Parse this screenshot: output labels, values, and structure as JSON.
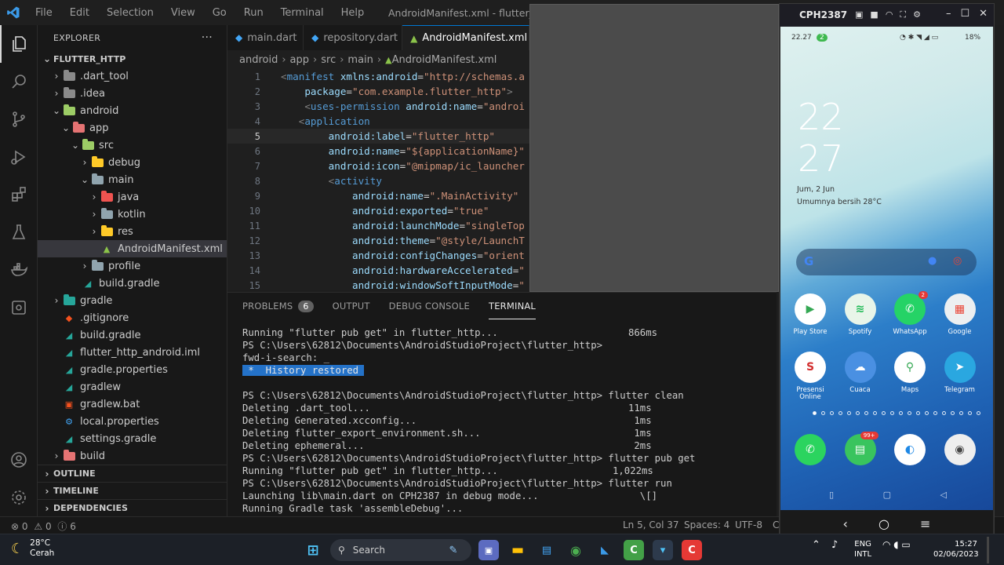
{
  "window": {
    "menu": [
      "File",
      "Edit",
      "Selection",
      "View",
      "Go",
      "Run",
      "Terminal",
      "Help"
    ],
    "title": "AndroidManifest.xml - flutter_http"
  },
  "explorer": {
    "header": "EXPLORER",
    "more": "···",
    "root": "FLUTTER_HTTP",
    "items": [
      {
        "label": ".dart_tool",
        "indent": 1,
        "chev": "›",
        "icon": "folder",
        "color": "#8a8a8a"
      },
      {
        "label": ".idea",
        "indent": 1,
        "chev": "›",
        "icon": "folder",
        "color": "#8a8a8a"
      },
      {
        "label": "android",
        "indent": 1,
        "chev": "⌄",
        "icon": "folder",
        "color": "#9ccc65"
      },
      {
        "label": "app",
        "indent": 2,
        "chev": "⌄",
        "icon": "folder",
        "color": "#e57373"
      },
      {
        "label": "src",
        "indent": 3,
        "chev": "⌄",
        "icon": "folder",
        "color": "#9ccc65"
      },
      {
        "label": "debug",
        "indent": 4,
        "chev": "›",
        "icon": "folder",
        "color": "#ffca28"
      },
      {
        "label": "main",
        "indent": 4,
        "chev": "⌄",
        "icon": "folder",
        "color": "#90a4ae"
      },
      {
        "label": "java",
        "indent": 5,
        "chev": "›",
        "icon": "folder",
        "color": "#ef5350"
      },
      {
        "label": "kotlin",
        "indent": 5,
        "chev": "›",
        "icon": "folder",
        "color": "#90a4ae"
      },
      {
        "label": "res",
        "indent": 5,
        "chev": "›",
        "icon": "folder",
        "color": "#ffca28"
      },
      {
        "label": "AndroidManifest.xml",
        "indent": 5,
        "chev": "",
        "icon": "android",
        "color": "#8bc34a",
        "selected": true
      },
      {
        "label": "profile",
        "indent": 4,
        "chev": "›",
        "icon": "folder",
        "color": "#90a4ae"
      },
      {
        "label": "build.gradle",
        "indent": 3,
        "chev": "",
        "icon": "gradle",
        "color": "#26a69a"
      },
      {
        "label": "gradle",
        "indent": 1,
        "chev": "›",
        "icon": "folder",
        "color": "#26a69a"
      },
      {
        "label": ".gitignore",
        "indent": 1,
        "chev": "",
        "icon": "git",
        "color": "#f4511e"
      },
      {
        "label": "build.gradle",
        "indent": 1,
        "chev": "",
        "icon": "gradle",
        "color": "#26a69a"
      },
      {
        "label": "flutter_http_android.iml",
        "indent": 1,
        "chev": "",
        "icon": "gradle",
        "color": "#26a69a"
      },
      {
        "label": "gradle.properties",
        "indent": 1,
        "chev": "",
        "icon": "gradle",
        "color": "#26a69a"
      },
      {
        "label": "gradlew",
        "indent": 1,
        "chev": "",
        "icon": "gradle",
        "color": "#26a69a"
      },
      {
        "label": "gradlew.bat",
        "indent": 1,
        "chev": "",
        "icon": "bat",
        "color": "#f4511e"
      },
      {
        "label": "local.properties",
        "indent": 1,
        "chev": "",
        "icon": "gear",
        "color": "#42a5f5"
      },
      {
        "label": "settings.gradle",
        "indent": 1,
        "chev": "",
        "icon": "gradle",
        "color": "#26a69a"
      },
      {
        "label": "build",
        "indent": 1,
        "chev": "›",
        "icon": "folder",
        "color": "#e57373"
      }
    ],
    "sections": [
      "OUTLINE",
      "TIMELINE",
      "DEPENDENCIES"
    ]
  },
  "tabs": [
    {
      "label": "main.dart",
      "icon": "◆",
      "color": "#42a5f5"
    },
    {
      "label": "repository.dart",
      "icon": "◆",
      "color": "#42a5f5"
    },
    {
      "label": "AndroidManifest.xml",
      "icon": "▲",
      "color": "#8bc34a",
      "active": true
    }
  ],
  "breadcrumb": [
    "android",
    "app",
    "src",
    "main",
    "AndroidManifest.xml"
  ],
  "code": {
    "current_line": 5,
    "lines": [
      [
        [
          "pu",
          "<"
        ],
        [
          "tg",
          "manifest"
        ],
        [
          "at",
          " xmlns:android"
        ],
        [
          "eq",
          "="
        ],
        [
          "st",
          "\"http://schemas.a"
        ]
      ],
      [
        [
          "at",
          "    package"
        ],
        [
          "eq",
          "="
        ],
        [
          "st",
          "\"com.example.flutter_http\""
        ],
        [
          "pu",
          ">"
        ]
      ],
      [
        [
          "pu",
          "    <"
        ],
        [
          "tg",
          "uses-permission"
        ],
        [
          "at",
          " android:name"
        ],
        [
          "eq",
          "="
        ],
        [
          "st",
          "\"androi"
        ]
      ],
      [
        [
          "pu",
          "   <"
        ],
        [
          "tg",
          "application"
        ]
      ],
      [
        [
          "at",
          "        android:label"
        ],
        [
          "eq",
          "="
        ],
        [
          "st",
          "\"flutter_http\""
        ]
      ],
      [
        [
          "at",
          "        android:name"
        ],
        [
          "eq",
          "="
        ],
        [
          "st",
          "\"${applicationName}\""
        ]
      ],
      [
        [
          "at",
          "        android:icon"
        ],
        [
          "eq",
          "="
        ],
        [
          "st",
          "\"@mipmap/ic_launcher"
        ]
      ],
      [
        [
          "pu",
          "        <"
        ],
        [
          "tg",
          "activity"
        ]
      ],
      [
        [
          "at",
          "            android:name"
        ],
        [
          "eq",
          "="
        ],
        [
          "st",
          "\".MainActivity\""
        ]
      ],
      [
        [
          "at",
          "            android:exported"
        ],
        [
          "eq",
          "="
        ],
        [
          "st",
          "\"true\""
        ]
      ],
      [
        [
          "at",
          "            android:launchMode"
        ],
        [
          "eq",
          "="
        ],
        [
          "st",
          "\"singleTop"
        ]
      ],
      [
        [
          "at",
          "            android:theme"
        ],
        [
          "eq",
          "="
        ],
        [
          "st",
          "\"@style/LaunchT"
        ]
      ],
      [
        [
          "at",
          "            android:configChanges"
        ],
        [
          "eq",
          "="
        ],
        [
          "st",
          "\"orient"
        ]
      ],
      [
        [
          "at",
          "            android:hardwareAccelerated"
        ],
        [
          "eq",
          "="
        ],
        [
          "st",
          "\""
        ]
      ],
      [
        [
          "at",
          "            android:windowSoftInputMode"
        ],
        [
          "eq",
          "="
        ],
        [
          "st",
          "\""
        ]
      ]
    ]
  },
  "panel": {
    "tabs": [
      "PROBLEMS",
      "OUTPUT",
      "DEBUG CONSOLE",
      "TERMINAL"
    ],
    "problems_count": "6",
    "terminal": [
      {
        "text": "Running \"flutter pub get\" in flutter_http...",
        "time": "866ms"
      },
      {
        "text": "PS C:\\Users\\62812\\Documents\\AndroidStudioProject\\flutter_http>"
      },
      {
        "text": "fwd-i-search: _"
      },
      {
        "text": " *  History restored ",
        "hl": true
      },
      {
        "text": ""
      },
      {
        "text": "PS C:\\Users\\62812\\Documents\\AndroidStudioProject\\flutter_http> flutter clean"
      },
      {
        "text": "Deleting .dart_tool...",
        "time": "11ms"
      },
      {
        "text": "Deleting Generated.xcconfig...",
        "time": " 1ms"
      },
      {
        "text": "Deleting flutter_export_environment.sh...",
        "time": " 1ms"
      },
      {
        "text": "Deleting ephemeral...",
        "time": " 2ms"
      },
      {
        "text": "PS C:\\Users\\62812\\Documents\\AndroidStudioProject\\flutter_http> flutter pub get"
      },
      {
        "text": "Running \"flutter pub get\" in flutter_http...",
        "time": "1,022ms"
      },
      {
        "text": "PS C:\\Users\\62812\\Documents\\AndroidStudioProject\\flutter_http> flutter run"
      },
      {
        "text": "Launching lib\\main.dart on CPH2387 in debug mode...",
        "time": "  \\[]"
      },
      {
        "text": "Running Gradle task 'assembleDebug'..."
      }
    ]
  },
  "status": {
    "errors": "0",
    "warnings": "0",
    "info": "6",
    "position": "Ln 5, Col 37",
    "spaces": "Spaces: 4",
    "encoding": "UTF-8",
    "cut": "C"
  },
  "phone": {
    "device": "CPH2387",
    "status_time": "22.27",
    "status_badge": "2",
    "battery": "18%",
    "clock_hour": "22",
    "clock_min": "27",
    "date": "Jum, 2 Jun",
    "weather": "Umumnya bersih  28°C",
    "apps_row1": [
      {
        "label": "Play Store",
        "bg": "#ffffff",
        "fg": "#34a853",
        "glyph": "▶"
      },
      {
        "label": "Spotify",
        "bg": "#e8f5e9",
        "fg": "#1db954",
        "glyph": "≋"
      },
      {
        "label": "WhatsApp",
        "bg": "#25d366",
        "fg": "#ffffff",
        "glyph": "✆",
        "badge": "2"
      },
      {
        "label": "Google",
        "bg": "#eceff1",
        "fg": "#ea4335",
        "glyph": "▦"
      }
    ],
    "apps_row2": [
      {
        "label": "Presensi Online",
        "bg": "#ffffff",
        "fg": "#d32f2f",
        "glyph": "S"
      },
      {
        "label": "Cuaca",
        "bg": "#4a90e2",
        "fg": "#ffffff",
        "glyph": "☁"
      },
      {
        "label": "Maps",
        "bg": "#ffffff",
        "fg": "#34a853",
        "glyph": "⚲"
      },
      {
        "label": "Telegram",
        "bg": "#2aa7e0",
        "fg": "#ffffff",
        "glyph": "➤"
      }
    ],
    "dock": [
      {
        "label": "",
        "bg": "#2bd45f",
        "fg": "#ffffff",
        "glyph": "✆"
      },
      {
        "label": "",
        "bg": "#39c45e",
        "fg": "#ffffff",
        "glyph": "▤",
        "badge": "99+"
      },
      {
        "label": "",
        "bg": "#ffffff",
        "fg": "#1e88e5",
        "glyph": "◐"
      },
      {
        "label": "",
        "bg": "#eeeeee",
        "fg": "#444444",
        "glyph": "◉"
      }
    ]
  },
  "taskbar": {
    "temp": "28°C",
    "condition": "Cerah",
    "search": "Search",
    "lang1": "ENG",
    "lang2": "INTL",
    "time": "15:27",
    "date": "02/06/2023"
  }
}
